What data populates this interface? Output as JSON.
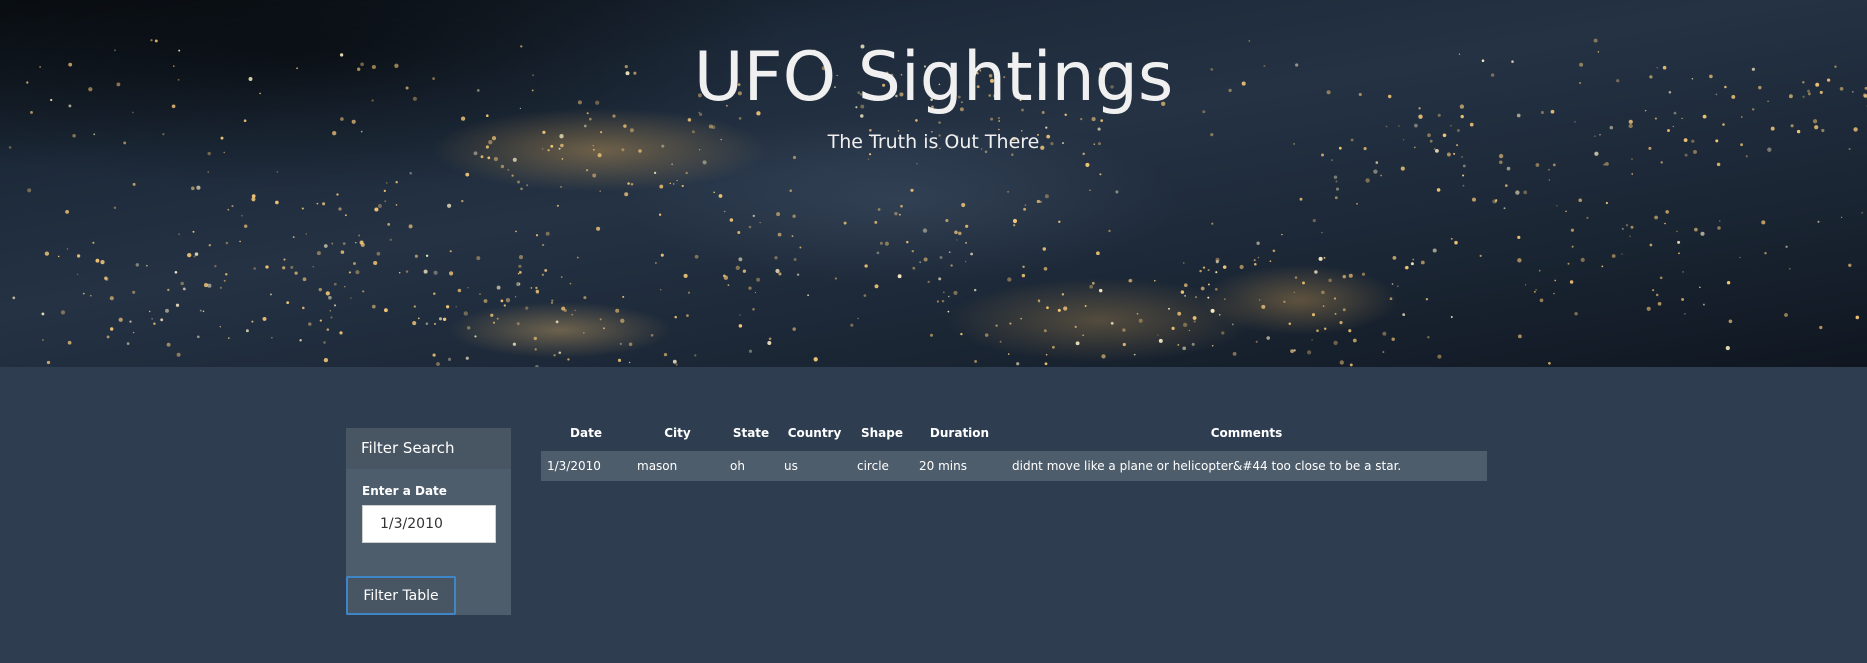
{
  "header": {
    "title": "UFO Sightings",
    "subtitle": "The Truth is Out There"
  },
  "filter": {
    "heading": "Filter Search",
    "date_label": "Enter a Date",
    "date_value": "1/3/2010",
    "button_label": "Filter Table"
  },
  "table": {
    "columns": [
      "Date",
      "City",
      "State",
      "Country",
      "Shape",
      "Duration",
      "Comments"
    ],
    "rows": [
      {
        "date": "1/3/2010",
        "city": "mason",
        "state": "oh",
        "country": "us",
        "shape": "circle",
        "duration": "20 mins",
        "comments": "didnt move like a plane or helicopter&#44 too close to be a star."
      }
    ]
  },
  "colors": {
    "page_background": "#2e3e50",
    "panel": "#4e5d6c",
    "button_border": "#3f86c8"
  }
}
